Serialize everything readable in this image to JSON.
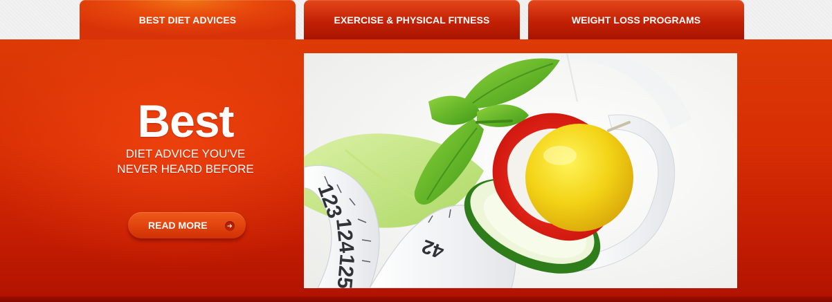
{
  "tabs": [
    {
      "label": "BEST DIET ADVICES",
      "active": true
    },
    {
      "label": "EXERCISE & PHYSICAL FITNESS",
      "active": false
    },
    {
      "label": "WEIGHT LOSS PROGRAMS",
      "active": false
    }
  ],
  "hero": {
    "headline": "Best",
    "sub_line_1": "DIET ADVICE YOU'VE",
    "sub_line_2": "NEVER HEARD BEFORE",
    "button_label": "READ MORE",
    "button_icon": "arrow-right-icon"
  },
  "image": {
    "tape_numbers": [
      "123",
      "124",
      "125",
      "42"
    ]
  },
  "colors": {
    "accent": "#d72e04",
    "tab_active": "#e84a0c",
    "text": "#ffffff"
  }
}
